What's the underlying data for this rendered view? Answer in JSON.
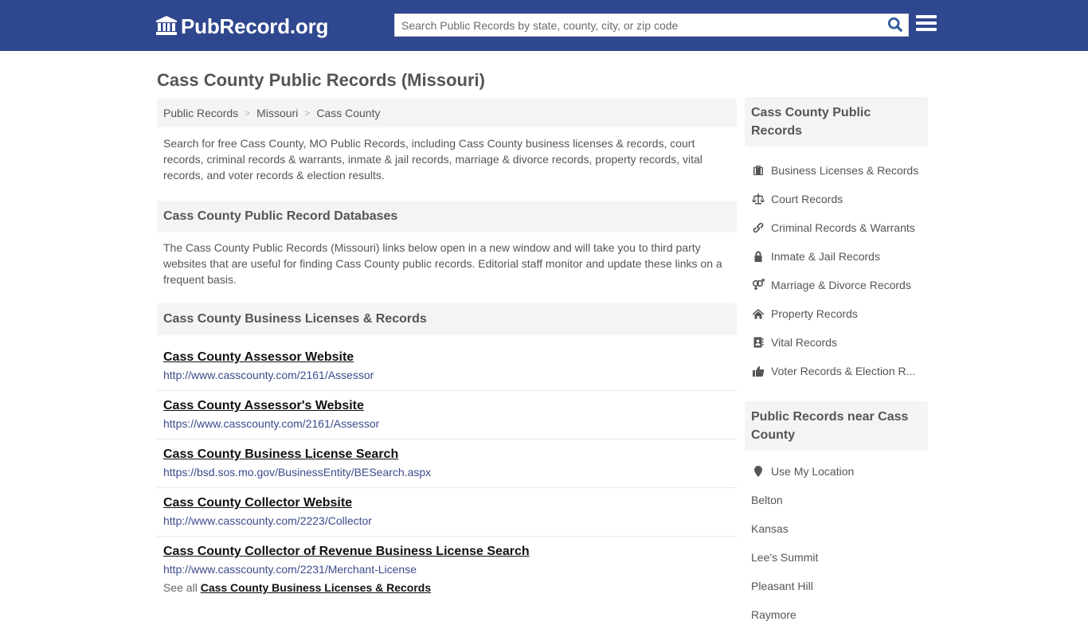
{
  "header": {
    "logo_text": "PubRecord.org",
    "logo_icon": "courthouse-icon",
    "search_placeholder": "Search Public Records by state, county, city, or zip code",
    "search_value": "",
    "search_icon": "search-icon",
    "menu_icon": "hamburger-menu-icon",
    "brand_color": "#2f478e"
  },
  "page": {
    "title": "Cass County Public Records (Missouri)"
  },
  "breadcrumb": [
    {
      "label": "Public Records"
    },
    {
      "label": "Missouri"
    },
    {
      "label": "Cass County"
    }
  ],
  "breadcrumb_separator": ">",
  "intro": "Search for free Cass County, MO Public Records, including Cass County business licenses & records, court records, criminal records & warrants, inmate & jail records, marriage & divorce records, property records, vital records, and voter records & election results.",
  "databases": {
    "heading": "Cass County Public Record Databases",
    "text": "The Cass County Public Records (Missouri) links below open in a new window and will take you to third party websites that are useful for finding Cass County public records. Editorial staff monitor and update these links on a frequent basis."
  },
  "business": {
    "heading": "Cass County Business Licenses & Records",
    "records": [
      {
        "title": "Cass County Assessor Website",
        "url": "http://www.casscounty.com/2161/Assessor"
      },
      {
        "title": "Cass County Assessor's Website",
        "url": "https://www.casscounty.com/2161/Assessor"
      },
      {
        "title": "Cass County Business License Search",
        "url": "https://bsd.sos.mo.gov/BusinessEntity/BESearch.aspx"
      },
      {
        "title": "Cass County Collector Website",
        "url": "http://www.casscounty.com/2223/Collector"
      },
      {
        "title": "Cass County Collector of Revenue Business License Search",
        "url": "http://www.casscounty.com/2231/Merchant-License"
      }
    ],
    "see_all_prefix": "See all",
    "see_all_link": "Cass County Business Licenses & Records"
  },
  "sidebar": {
    "records_heading": "Cass County Public Records",
    "records_items": [
      {
        "label": "Business Licenses & Records",
        "icon": "briefcase-icon"
      },
      {
        "label": "Court Records",
        "icon": "scales-icon"
      },
      {
        "label": "Criminal Records & Warrants",
        "icon": "link-icon"
      },
      {
        "label": "Inmate & Jail Records",
        "icon": "lock-icon"
      },
      {
        "label": "Marriage & Divorce Records",
        "icon": "gender-symbols-icon"
      },
      {
        "label": "Property Records",
        "icon": "home-icon"
      },
      {
        "label": "Vital Records",
        "icon": "address-book-icon"
      },
      {
        "label": "Voter Records & Election R...",
        "icon": "thumbs-up-icon"
      }
    ],
    "near_heading": "Public Records near Cass County",
    "use_location": "Use My Location",
    "location_icon": "map-marker-icon",
    "near_items": [
      "Belton",
      "Kansas",
      "Lee's Summit",
      "Pleasant Hill",
      "Raymore"
    ]
  }
}
